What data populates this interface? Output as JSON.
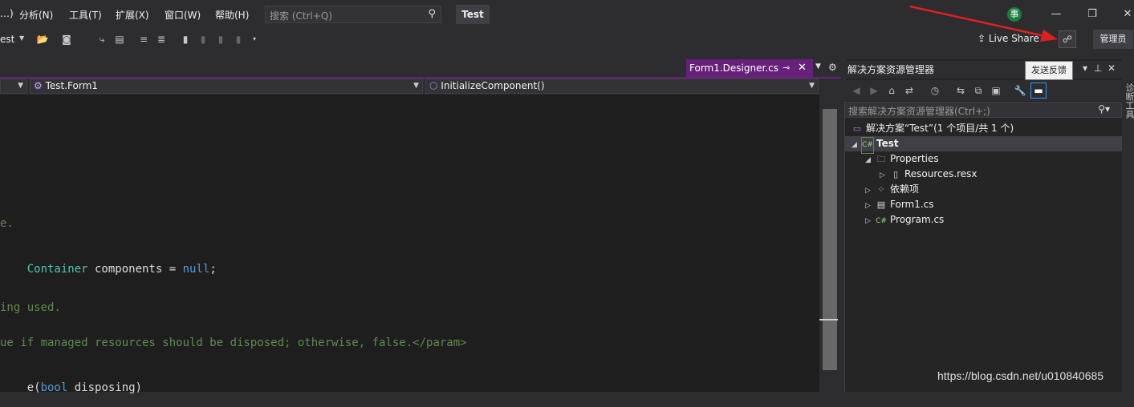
{
  "menubar": {
    "items": [
      "…)",
      "分析(N)",
      "工具(T)",
      "扩展(X)",
      "窗口(W)",
      "帮助(H)"
    ],
    "search_placeholder": "搜索 (Ctrl+Q)",
    "solution_name": "Test",
    "avatar_initial": "事",
    "window_controls": [
      "minimize-icon",
      "restore-icon",
      "close-icon"
    ]
  },
  "toolbar": {
    "config_label": "est",
    "liveshare_label": "Live Share",
    "admin_label": "管理员",
    "feedback_tooltip": "发送反馈"
  },
  "document": {
    "tab_title": "Form1.Designer.cs",
    "nav_left": "",
    "nav_class": "Test.Form1",
    "nav_member": "InitializeComponent()"
  },
  "code_lines": [
    {
      "pre": "",
      "text": "e.",
      "kind": "comment"
    },
    {
      "pre": "",
      "parts": [
        [
          "Container",
          "type"
        ],
        [
          " components = ",
          "plain"
        ],
        [
          "null",
          "kw"
        ],
        [
          ";",
          "plain"
        ]
      ]
    },
    {
      "pre": "",
      "text": "ing used.",
      "kind": "comment"
    },
    {
      "pre": "",
      "text": "ue if managed resources should be disposed; otherwise, false.</param>",
      "kind": "comment"
    },
    {
      "pre": "",
      "parts": [
        [
          "e(",
          "plain"
        ],
        [
          "bool",
          "kw"
        ],
        [
          " disposing)",
          "plain"
        ]
      ]
    }
  ],
  "solution_explorer": {
    "title": "解决方案资源管理器",
    "search_placeholder": "搜索解决方案资源管理器(Ctrl+;)",
    "tree": [
      {
        "label": "解决方案“Test”(1 个项目/共 1 个)",
        "indent": 0,
        "exp": "",
        "icon": "solution-icon"
      },
      {
        "label": "Test",
        "indent": 1,
        "exp": "◢",
        "icon": "csharp-project-icon",
        "bold": true,
        "selected": true
      },
      {
        "label": "Properties",
        "indent": 2,
        "exp": "◢",
        "icon": "folder-icon"
      },
      {
        "label": "Resources.resx",
        "indent": 3,
        "exp": "▷",
        "icon": "file-icon"
      },
      {
        "label": "依赖项",
        "indent": 2,
        "exp": "▷",
        "icon": "dependencies-icon"
      },
      {
        "label": "Form1.cs",
        "indent": 2,
        "exp": "▷",
        "icon": "form-icon"
      },
      {
        "label": "Program.cs",
        "indent": 2,
        "exp": "▷",
        "icon": "csharp-file-icon"
      }
    ]
  },
  "side_strip_label": "诊断工具",
  "watermark": "https://blog.csdn.net/u010840685",
  "colors": {
    "accent": "#68217a",
    "annotation_arrow": "#e02020"
  }
}
